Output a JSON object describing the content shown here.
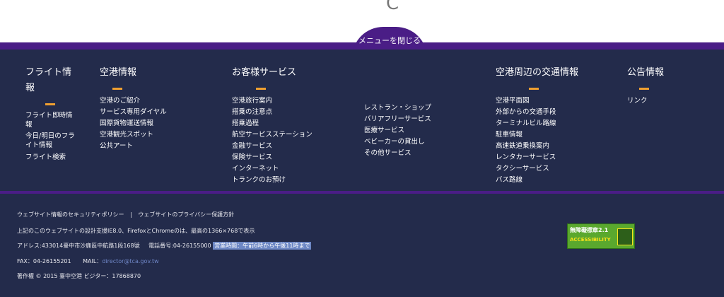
{
  "top": {
    "glyph": "C"
  },
  "menu": {
    "close_label": "メニューを閉じる",
    "columns": [
      {
        "title": "フライト情報",
        "items": [
          "フライト即時情報",
          "今日/明日のフライト情報",
          "フライト検索"
        ]
      },
      {
        "title": "空港情報",
        "items": [
          "空港のご紹介",
          "サービス専用ダイヤル",
          "国際貨物運送情報",
          "空港観光スポット",
          "公共アート"
        ]
      },
      {
        "title": "お客様サービス",
        "items": [
          "空港旅行案内",
          "搭乗の注意点",
          "搭乗過程",
          "航空サービスステーション",
          "金融サービス",
          "保険サービス",
          "インターネット",
          "トランクのお預け"
        ]
      },
      {
        "title": "",
        "items": [
          "レストラン・ショップ",
          "バリアフリーサービス",
          "医療サービス",
          "ベビーカーの貸出し",
          "その他サービス"
        ]
      },
      {
        "title": "空港周辺の交通情報",
        "items": [
          "空港平面図",
          "外部からの交通手段",
          "ターミナルビル路線",
          "駐車情報",
          "高速鉄道乗換案内",
          "レンタカーサービス",
          "タクシーサービス",
          "バス路線"
        ]
      },
      {
        "title": "公告情報",
        "items": [
          "リンク"
        ]
      }
    ]
  },
  "footer": {
    "security_policy": "ウェブサイト情報のセキュリティポリシー",
    "separator": "|",
    "privacy_policy": "ウェブサイトのプライバシー保護方針",
    "browser_note": "上記のこのウェブサイトの設計支援IE8.0、FirefoxとChromeのは、最高の1366×768で表示",
    "address": "アドレス:433014臺中市沙鹿區中航路1段168號",
    "phone": "電話番号:04-26155000",
    "hours": "営業時間：午前6時から午後11時まで",
    "fax": "FAX：04-26155201",
    "mail_label": "MAIL：",
    "mail": "director@tca.gov.tw",
    "copyright": "著作權 © 2015 臺中空港 ビジター：17868870",
    "badge_text": "無障礙標章2.1",
    "badge_sub": "ACCESSIBILITY"
  },
  "colors": {
    "navy": "#232b4b",
    "purple": "#4a1d86",
    "accent": "#f0a030"
  }
}
